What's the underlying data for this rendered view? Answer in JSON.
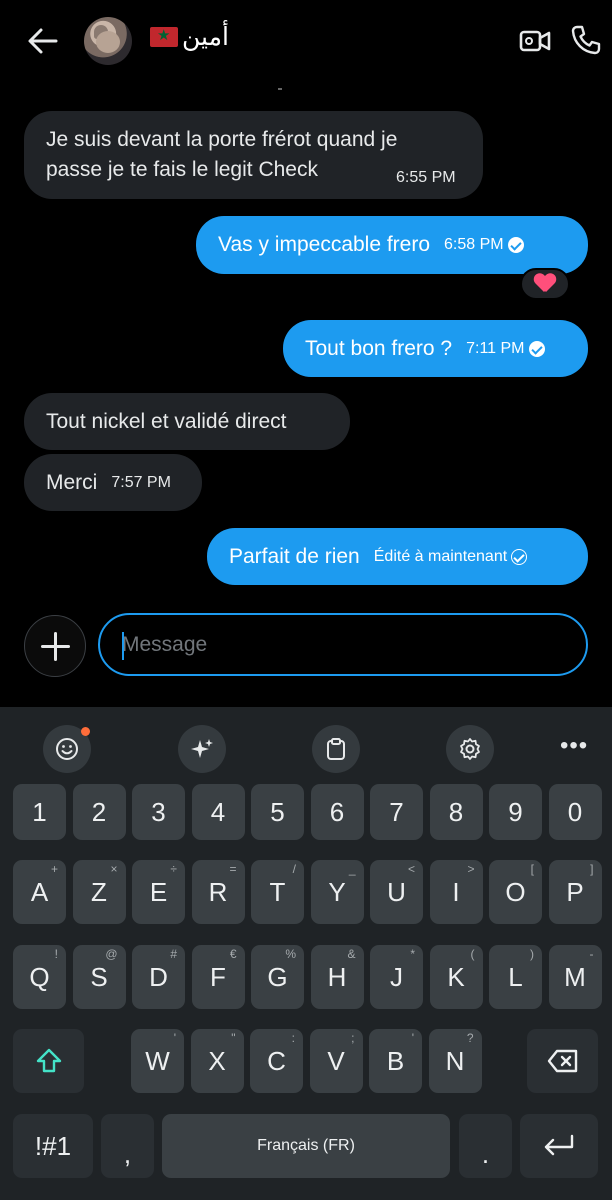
{
  "header": {
    "contact_name": "أمين",
    "flag_icon": "morocco-flag-icon"
  },
  "messages": [
    {
      "dir": "in",
      "lines": [
        "Je suis devant la porte frérot quand je",
        "passe je te fais le legit Check"
      ],
      "time": "6:55 PM"
    },
    {
      "dir": "out",
      "text": "Vas y impeccable frero",
      "time": "6:58 PM",
      "reaction": "heart"
    },
    {
      "dir": "out",
      "text": "Tout bon frero ?",
      "time": "7:11 PM"
    },
    {
      "dir": "in",
      "text": "Tout nickel et validé direct"
    },
    {
      "dir": "in",
      "text": "Merci",
      "time": "7:57 PM"
    },
    {
      "dir": "out",
      "text": "Parfait de rien",
      "status": "Édité à maintenant"
    }
  ],
  "composer": {
    "placeholder": "Message"
  },
  "keyboard": {
    "row1": [
      "1",
      "2",
      "3",
      "4",
      "5",
      "6",
      "7",
      "8",
      "9",
      "0"
    ],
    "row2": [
      [
        "A",
        "+"
      ],
      [
        "Z",
        "×"
      ],
      [
        "E",
        "÷"
      ],
      [
        "R",
        "="
      ],
      [
        "T",
        "/"
      ],
      [
        "Y",
        "_"
      ],
      [
        "U",
        "<"
      ],
      [
        "I",
        ">"
      ],
      [
        "O",
        "["
      ],
      [
        "P",
        "]"
      ]
    ],
    "row3": [
      [
        "Q",
        "!"
      ],
      [
        "S",
        "@"
      ],
      [
        "D",
        "#"
      ],
      [
        "F",
        "€"
      ],
      [
        "G",
        "%"
      ],
      [
        "H",
        "&"
      ],
      [
        "J",
        "*"
      ],
      [
        "K",
        "("
      ],
      [
        "L",
        ")"
      ],
      [
        "M",
        "-"
      ]
    ],
    "row4": [
      [
        "W",
        "'"
      ],
      [
        "X",
        "\""
      ],
      [
        "C",
        ":"
      ],
      [
        "V",
        ";"
      ],
      [
        "B",
        "'"
      ],
      [
        "N",
        "?"
      ]
    ],
    "symbols_key": "!#1",
    "comma": ",",
    "space_label": "Français (FR)",
    "period": "."
  },
  "colors": {
    "accent": "#1d9bf0",
    "bubble_in": "#202327",
    "background": "#000000",
    "keyboard": "#1f2326"
  }
}
